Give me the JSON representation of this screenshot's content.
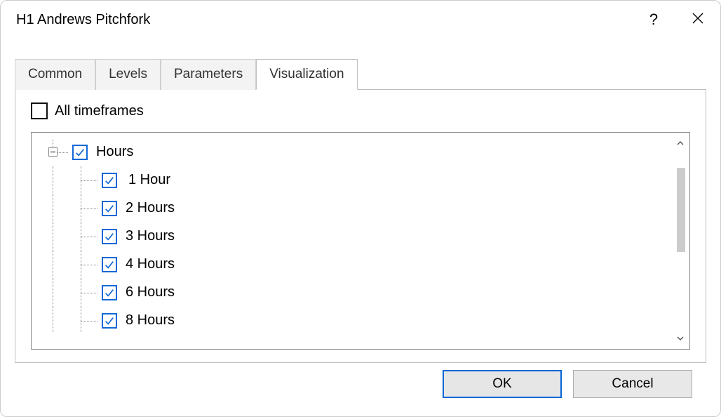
{
  "window": {
    "title": "H1 Andrews Pitchfork"
  },
  "tabs": {
    "common": "Common",
    "levels": "Levels",
    "parameters": "Parameters",
    "visualization": "Visualization"
  },
  "visualization": {
    "all_timeframes": "All timeframes",
    "all_timeframes_checked": false,
    "tree": {
      "parent": "Hours",
      "parent_checked": true,
      "items": [
        {
          "label": "1 Hour",
          "checked": true
        },
        {
          "label": "2 Hours",
          "checked": true
        },
        {
          "label": "3 Hours",
          "checked": true
        },
        {
          "label": "4 Hours",
          "checked": true
        },
        {
          "label": "6 Hours",
          "checked": true
        },
        {
          "label": "8 Hours",
          "checked": true
        }
      ]
    }
  },
  "buttons": {
    "ok": "OK",
    "cancel": "Cancel"
  }
}
